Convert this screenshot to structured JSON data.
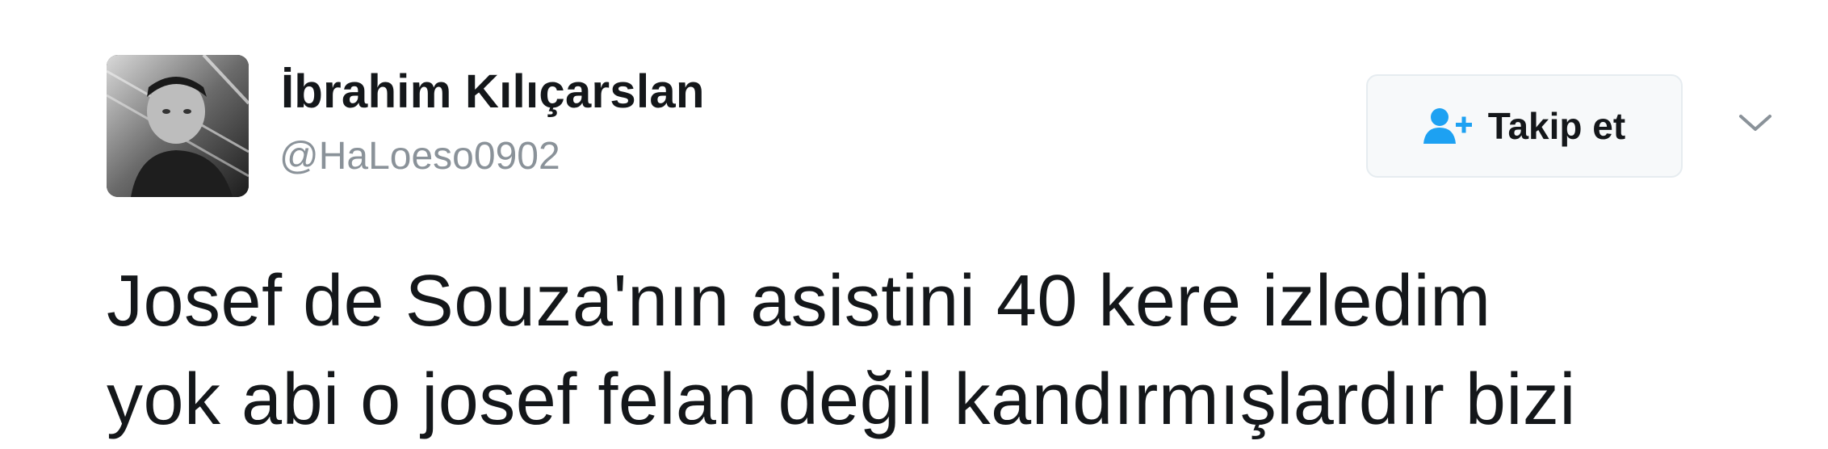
{
  "user": {
    "name": "İbrahim Kılıçarslan",
    "handle": "@HaLoeso0902",
    "avatar_icon": "profile-photo"
  },
  "follow": {
    "label": "Takip et",
    "icon": "add-person-icon",
    "icon_color": "#1da1f2"
  },
  "menu": {
    "icon": "chevron-down-icon"
  },
  "tweet": {
    "lines": [
      "Josef de Souza'nın asistini 40 kere izledim",
      "yok abi o josef felan değil kandırmışlardır bizi"
    ]
  }
}
